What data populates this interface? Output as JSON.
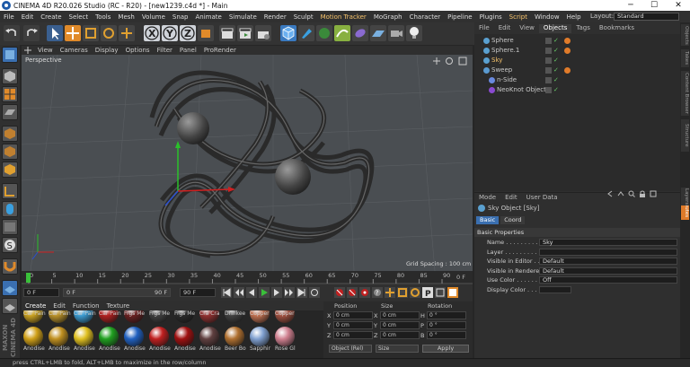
{
  "titlebar": {
    "title": "CINEMA 4D R20.026 Studio (RC - R20) - [new1239.c4d *] - Main",
    "min": "─",
    "max": "☐",
    "close": "✕"
  },
  "menubar": {
    "items": [
      {
        "label": "File",
        "hl": false
      },
      {
        "label": "Edit",
        "hl": false
      },
      {
        "label": "Create",
        "hl": false
      },
      {
        "label": "Select",
        "hl": false
      },
      {
        "label": "Tools",
        "hl": false
      },
      {
        "label": "Mesh",
        "hl": false
      },
      {
        "label": "Volume",
        "hl": false
      },
      {
        "label": "Snap",
        "hl": false
      },
      {
        "label": "Animate",
        "hl": false
      },
      {
        "label": "Simulate",
        "hl": false
      },
      {
        "label": "Render",
        "hl": false
      },
      {
        "label": "Sculpt",
        "hl": false
      },
      {
        "label": "Motion Tracker",
        "hl": true
      },
      {
        "label": "MoGraph",
        "hl": false
      },
      {
        "label": "Character",
        "hl": false
      },
      {
        "label": "Pipeline",
        "hl": false
      },
      {
        "label": "Plugins",
        "hl": false
      },
      {
        "label": "Script",
        "hl": true
      },
      {
        "label": "Window",
        "hl": false
      },
      {
        "label": "Help",
        "hl": false
      }
    ],
    "layout_label": "Layout:",
    "layout_value": "Standard"
  },
  "viewport": {
    "menu": [
      "View",
      "Cameras",
      "Display",
      "Options",
      "Filter",
      "Panel",
      "ProRender"
    ],
    "label": "Perspective",
    "grid": "Grid Spacing : 100 cm"
  },
  "timeline": {
    "ticks": [
      "0",
      "5",
      "10",
      "15",
      "20",
      "25",
      "30",
      "35",
      "40",
      "45",
      "50",
      "55",
      "60",
      "65",
      "70",
      "75",
      "80",
      "85",
      "90"
    ],
    "end": "0 F"
  },
  "tlctl": {
    "start": "0 F",
    "cur": "0 F",
    "maxv": "90 F",
    "end": "90 F"
  },
  "objects": {
    "tabs": [
      "File",
      "Edit",
      "View",
      "Objects",
      "Tags",
      "Bookmarks"
    ],
    "rows": [
      {
        "name": "Sphere",
        "color": "#5aa0d0",
        "indent": 0,
        "tag": true,
        "sel": false
      },
      {
        "name": "Sphere.1",
        "color": "#5aa0d0",
        "indent": 0,
        "tag": true,
        "sel": false
      },
      {
        "name": "Sky",
        "color": "#5aa0d0",
        "indent": 0,
        "tag": false,
        "sel": true
      },
      {
        "name": "Sweep",
        "color": "#5a9ad0",
        "indent": 0,
        "tag": true,
        "sel": false
      },
      {
        "name": "n-Side",
        "color": "#6a8adf",
        "indent": 1,
        "tag": false,
        "sel": false
      },
      {
        "name": "NeoKnot Object",
        "color": "#8a4ad0",
        "indent": 1,
        "tag": false,
        "sel": false
      }
    ]
  },
  "attributes": {
    "tabs": [
      "Mode",
      "Edit",
      "User Data"
    ],
    "object": "Sky Object [Sky]",
    "subtabs": [
      "Basic",
      "Coord"
    ],
    "section": "Basic Properties",
    "props": [
      {
        "label": "Name . . . . . . . . . . .",
        "value": "Sky"
      },
      {
        "label": "Layer . . . . . . . . . . .",
        "value": ""
      },
      {
        "label": "Visible in Editor . .",
        "value": "Default"
      },
      {
        "label": "Visible in Renderer",
        "value": "Default"
      },
      {
        "label": "Use Color . . . . . . .",
        "value": "Off"
      },
      {
        "label": "Display Color . . . .",
        "value": ""
      }
    ]
  },
  "sidetabs": [
    "Objects",
    "Takes",
    "Content Browser",
    "Structure",
    "Attributes",
    "Layers"
  ],
  "materials": {
    "menu": [
      "Create",
      "Edit",
      "Function",
      "Texture"
    ],
    "top": [
      "Car Pain",
      "Car Pain",
      "Car Pain",
      "Car Pain",
      "Frgs Me",
      "Frgs Me",
      "Frgs Me",
      "Cra Cra",
      "Drinkee",
      "Copper",
      "Copper"
    ],
    "bottom": [
      "Anodise",
      "Anodise",
      "Anodise",
      "Anodise",
      "Anodise",
      "Anodise",
      "Anodise",
      "Anodise",
      "Beer Bo",
      "Sapphir",
      "Rose Gl"
    ],
    "top_colors": [
      "#c8a020",
      "#b89028",
      "#3a9ad0",
      "#b02020",
      "#6a2020",
      "#404040",
      "#2a2a2a",
      "#903030",
      "#404040",
      "#c07050",
      "#a05040"
    ],
    "bottom_colors": [
      "#d0a018",
      "#c09020",
      "#e0c020",
      "#20a020",
      "#2060c0",
      "#c02020",
      "#a01010",
      "#604040",
      "#b07030",
      "#80a0d0",
      "#d08090"
    ]
  },
  "coords": {
    "headers": [
      "Position",
      "Size",
      "Rotation"
    ],
    "rows": [
      {
        "a": "X",
        "p": "0 cm",
        "b": "X",
        "s": "0 cm",
        "c": "H",
        "r": "0 °"
      },
      {
        "a": "Y",
        "p": "0 cm",
        "b": "Y",
        "s": "0 cm",
        "c": "P",
        "r": "0 °"
      },
      {
        "a": "Z",
        "p": "0 cm",
        "b": "Z",
        "s": "0 cm",
        "c": "B",
        "r": "0 °"
      }
    ],
    "mode": "Object (Rel)",
    "size": "Size",
    "apply": "Apply"
  },
  "status": "press CTRL+LMB to fold, ALT+LMB to maximize in the row/column",
  "brand": "MAXON CINEMA 4D"
}
